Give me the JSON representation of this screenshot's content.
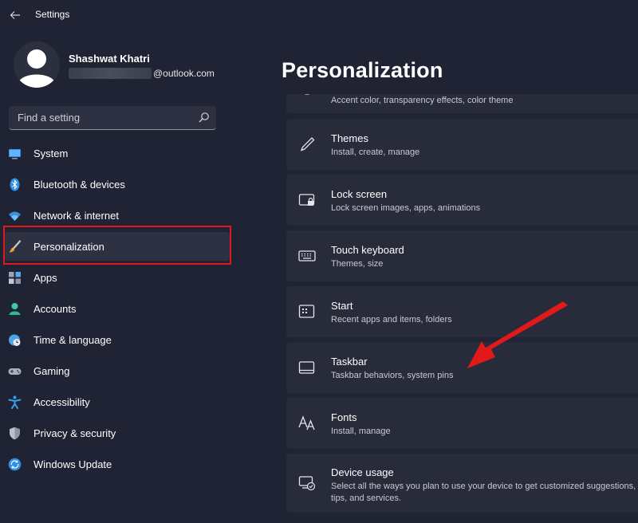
{
  "window": {
    "title": "Settings"
  },
  "profile": {
    "name": "Shashwat Khatri",
    "email_domain": "@outlook.com"
  },
  "search": {
    "placeholder": "Find a setting"
  },
  "sidebar": {
    "items": [
      {
        "label": "System",
        "icon": "system-icon",
        "selected": false
      },
      {
        "label": "Bluetooth & devices",
        "icon": "bluetooth-icon",
        "selected": false
      },
      {
        "label": "Network & internet",
        "icon": "wifi-icon",
        "selected": false
      },
      {
        "label": "Personalization",
        "icon": "brush-icon",
        "selected": true
      },
      {
        "label": "Apps",
        "icon": "apps-icon",
        "selected": false
      },
      {
        "label": "Accounts",
        "icon": "person-icon",
        "selected": false
      },
      {
        "label": "Time & language",
        "icon": "clock-globe-icon",
        "selected": false
      },
      {
        "label": "Gaming",
        "icon": "gamepad-icon",
        "selected": false
      },
      {
        "label": "Accessibility",
        "icon": "accessibility-icon",
        "selected": false
      },
      {
        "label": "Privacy & security",
        "icon": "shield-icon",
        "selected": false
      },
      {
        "label": "Windows Update",
        "icon": "update-icon",
        "selected": false
      }
    ]
  },
  "main": {
    "title": "Personalization",
    "cards": [
      {
        "title": "",
        "subtitle": "Accent color, transparency effects, color theme",
        "icon": "palette-icon"
      },
      {
        "title": "Themes",
        "subtitle": "Install, create, manage",
        "icon": "pen-icon"
      },
      {
        "title": "Lock screen",
        "subtitle": "Lock screen images, apps, animations",
        "icon": "lock-screen-icon"
      },
      {
        "title": "Touch keyboard",
        "subtitle": "Themes, size",
        "icon": "keyboard-icon"
      },
      {
        "title": "Start",
        "subtitle": "Recent apps and items, folders",
        "icon": "start-icon"
      },
      {
        "title": "Taskbar",
        "subtitle": "Taskbar behaviors, system pins",
        "icon": "taskbar-icon"
      },
      {
        "title": "Fonts",
        "subtitle": "Install, manage",
        "icon": "fonts-icon"
      },
      {
        "title": "Device usage",
        "subtitle": "Select all the ways you plan to use your device to get customized suggestions, tips, and services.",
        "icon": "device-usage-icon"
      }
    ]
  },
  "colors": {
    "highlight": "#e01a1a",
    "accent": "#4cc2ff",
    "arrow": "#e01a1a"
  }
}
